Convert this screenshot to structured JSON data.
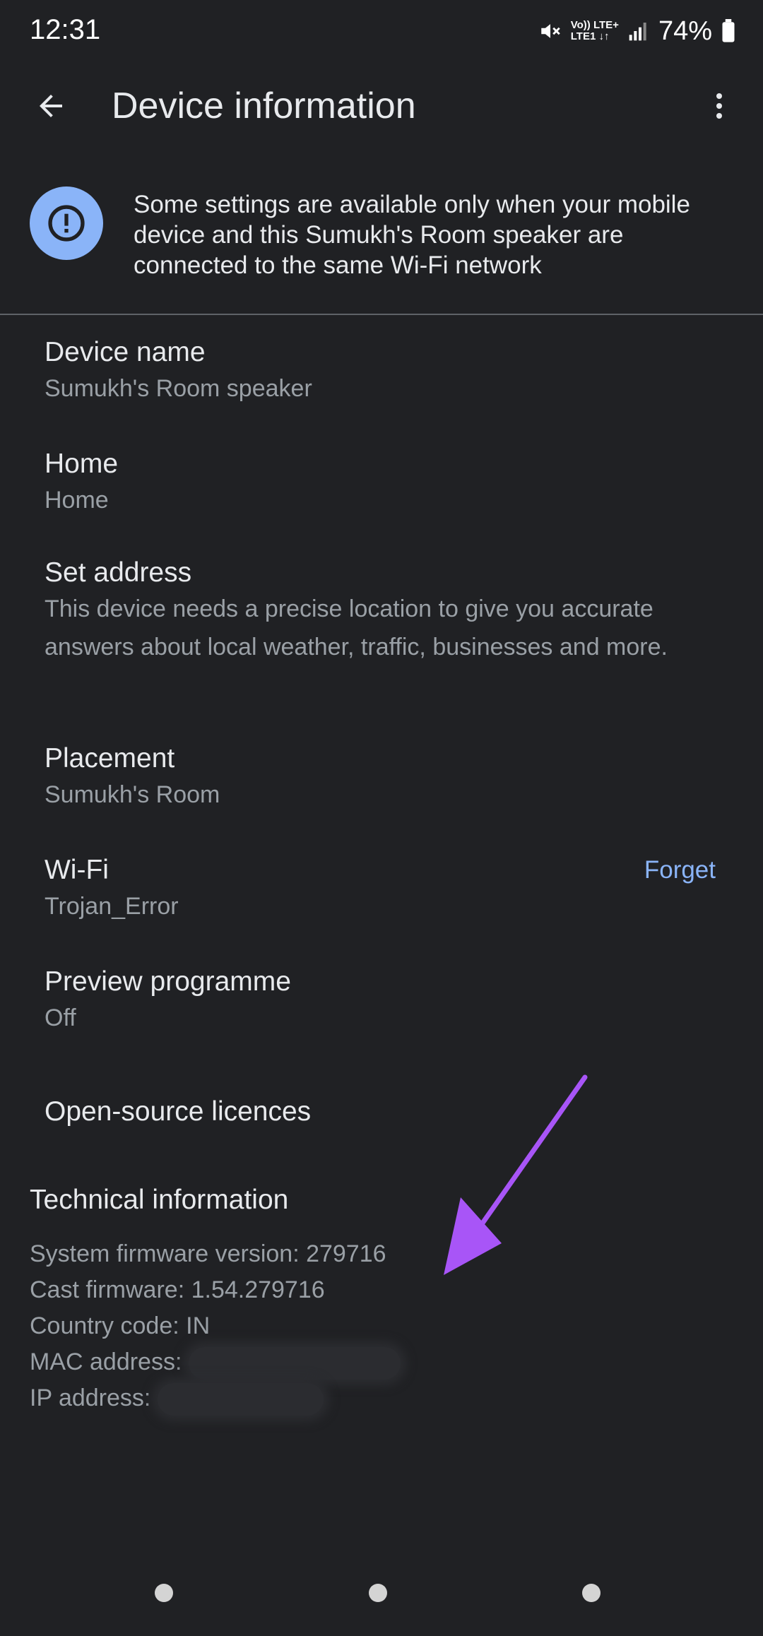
{
  "status_bar": {
    "time": "12:31",
    "network_top": "Vo)) LTE+",
    "network_bottom": "LTE1 ↓↑",
    "battery_percent": "74%"
  },
  "app_bar": {
    "title": "Device information"
  },
  "banner": {
    "text": "Some settings are available only when your mobile device and this Sumukh's Room speaker are connected to the same Wi-Fi network",
    "accent_color": "#8ab4f8"
  },
  "settings": {
    "device_name": {
      "title": "Device name",
      "value": "Sumukh's Room speaker"
    },
    "home": {
      "title": "Home",
      "value": "Home"
    },
    "set_address": {
      "title": "Set address",
      "value": "This device needs a precise location to give you accurate answers about local weather, traffic, businesses and more."
    },
    "placement": {
      "title": "Placement",
      "value": "Sumukh's Room"
    },
    "wifi": {
      "title": "Wi-Fi",
      "value": "Trojan_Error",
      "action": "Forget"
    },
    "preview": {
      "title": "Preview programme",
      "value": "Off"
    },
    "licences": {
      "title": "Open-source licences"
    }
  },
  "technical": {
    "heading": "Technical information",
    "system_firmware": "System firmware version: 279716",
    "cast_firmware": "Cast firmware: 1.54.279716",
    "country_code": "Country code: IN",
    "mac_label": "MAC address:",
    "ip_label": "IP address:"
  },
  "annotation_color": "#a855f7"
}
